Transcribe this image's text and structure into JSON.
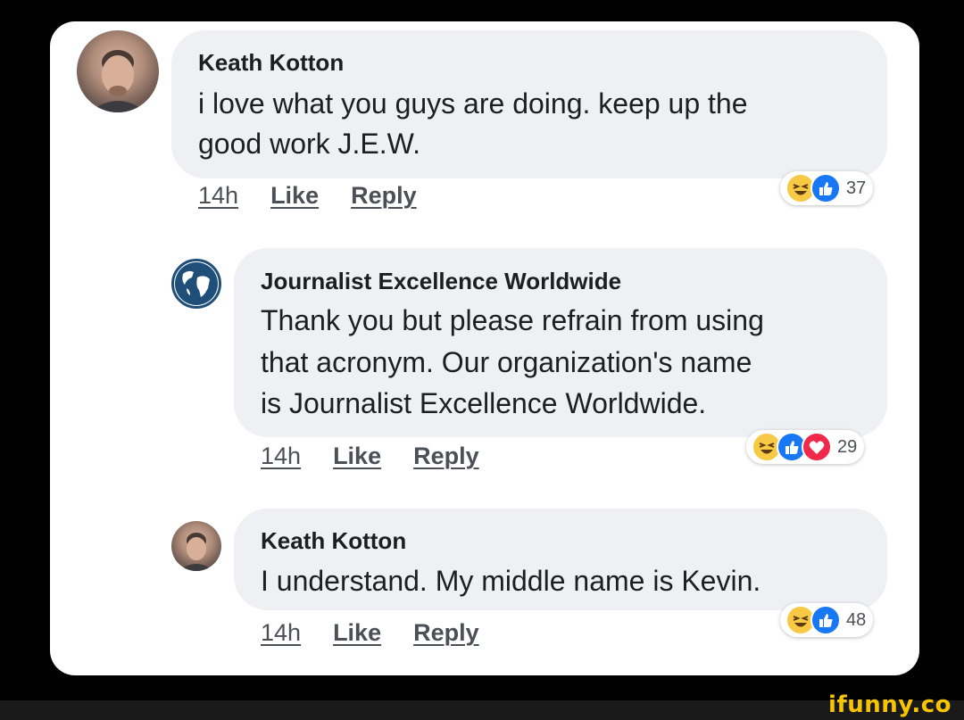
{
  "comments": [
    {
      "author": "Keath Kotton",
      "text_lines": [
        "i love what you guys are doing.  keep up the",
        "good work J.E.W."
      ],
      "time": "14h",
      "like": "Like",
      "reply": "Reply",
      "reaction_count": "37",
      "reactions": [
        "haha-icon",
        "like-icon"
      ]
    },
    {
      "author": "Journalist Excellence Worldwide",
      "text_lines": [
        "Thank you but please refrain from using",
        "that acronym. Our organization's name",
        "is Journalist Excellence Worldwide."
      ],
      "time": "14h",
      "like": "Like",
      "reply": "Reply",
      "reaction_count": "29",
      "reactions": [
        "haha-icon",
        "like-icon",
        "love-icon"
      ]
    },
    {
      "author": "Keath Kotton",
      "text_lines": [
        "I understand.  My middle name is Kevin."
      ],
      "time": "14h",
      "like": "Like",
      "reply": "Reply",
      "reaction_count": "48",
      "reactions": [
        "haha-icon",
        "like-icon"
      ]
    }
  ],
  "watermark": "ifunny.co",
  "colors": {
    "bubble": "#eff0f4",
    "like_blue": "#1877f2",
    "love_red": "#f0284a",
    "haha_yellow": "#f7c944",
    "globe_blue": "#1f4e79"
  }
}
